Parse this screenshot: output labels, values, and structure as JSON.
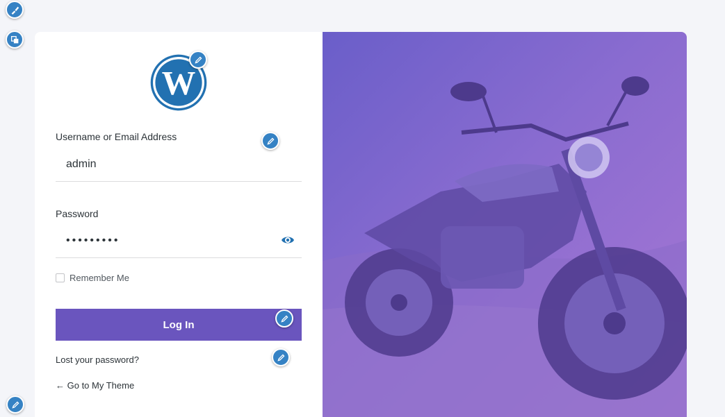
{
  "login": {
    "username_label": "Username or Email Address",
    "username_value": "admin",
    "password_label": "Password",
    "password_value": "•••••••••",
    "remember_label": "Remember Me",
    "login_button": "Log In",
    "lost_password": "Lost your password?",
    "back_link": "← Go to My Theme"
  },
  "icons": {
    "logo": "wordpress-logo",
    "edit": "pencil-icon",
    "show_password": "eye-icon",
    "customizer_top": "brush-icon",
    "customizer_second": "layers-icon"
  },
  "colors": {
    "button": "#6a55be",
    "shortcut": "#3582c4",
    "wp_blue": "#2271b1",
    "gradient_start": "#6a5ec9",
    "gradient_end": "#a877d4"
  }
}
